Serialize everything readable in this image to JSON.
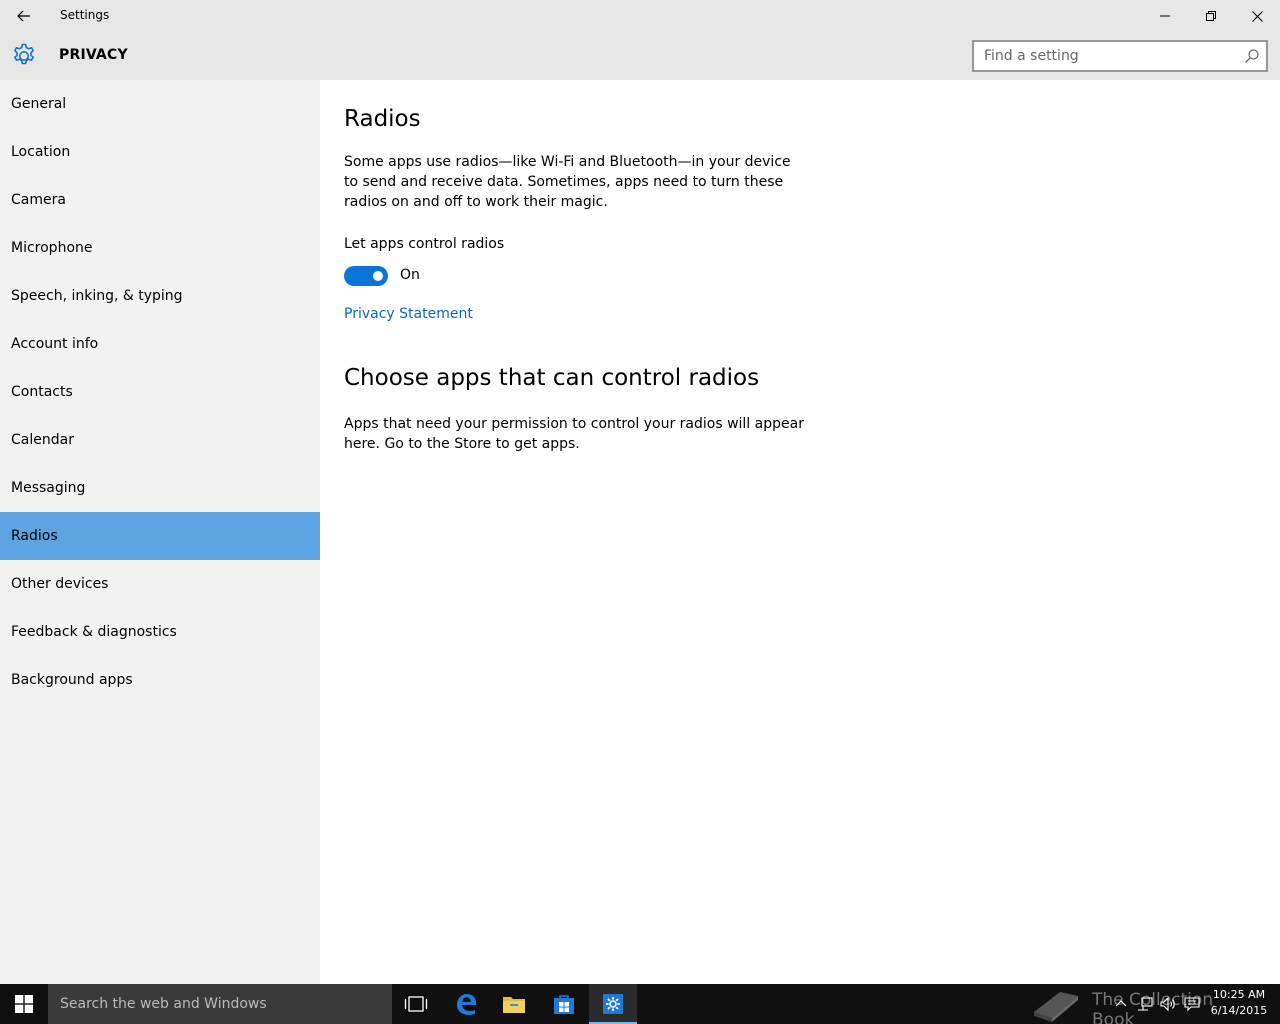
{
  "window": {
    "title": "Settings",
    "controls": {
      "minimize": "minimize",
      "maximize": "restore",
      "close": "close"
    }
  },
  "header": {
    "icon": "gear-icon",
    "section_title": "PRIVACY",
    "search_placeholder": "Find a setting",
    "search_value": ""
  },
  "sidebar": {
    "items": [
      {
        "label": "General",
        "active": false
      },
      {
        "label": "Location",
        "active": false
      },
      {
        "label": "Camera",
        "active": false
      },
      {
        "label": "Microphone",
        "active": false
      },
      {
        "label": "Speech, inking, & typing",
        "active": false
      },
      {
        "label": "Account info",
        "active": false
      },
      {
        "label": "Contacts",
        "active": false
      },
      {
        "label": "Calendar",
        "active": false
      },
      {
        "label": "Messaging",
        "active": false
      },
      {
        "label": "Radios",
        "active": true
      },
      {
        "label": "Other devices",
        "active": false
      },
      {
        "label": "Feedback & diagnostics",
        "active": false
      },
      {
        "label": "Background apps",
        "active": false
      }
    ]
  },
  "main": {
    "title": "Radios",
    "description": "Some apps use radios—like Wi-Fi and Bluetooth—in your device to send and receive data. Sometimes, apps need to turn these radios on and off to work their magic.",
    "toggle": {
      "label": "Let apps control radios",
      "state_text": "On",
      "on": true
    },
    "privacy_link": "Privacy Statement",
    "section2_title": "Choose apps that can control radios",
    "section2_description": "Apps that need your permission to control your radios will appear here. Go to the Store to get apps."
  },
  "taskbar": {
    "search_placeholder": "Search the web and Windows",
    "apps": [
      "task-view-icon",
      "edge-icon",
      "file-explorer-icon",
      "store-icon",
      "settings-icon"
    ],
    "active_app": "settings-icon",
    "watermark": "The Collection Book",
    "clock": {
      "time": "10:25 AM",
      "date": "6/14/2015"
    }
  },
  "colors": {
    "accent": "#0a74da",
    "selected_nav": "#5ea4e1",
    "link": "#0a66c2",
    "chrome": "#e6e6e6",
    "sidebar": "#f2f2f2",
    "taskbar": "#101010"
  }
}
